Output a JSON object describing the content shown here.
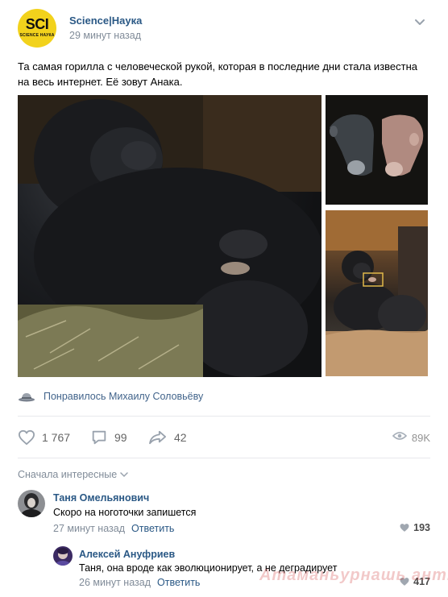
{
  "post": {
    "group_name": "Science|Наука",
    "time": "29 минут назад",
    "avatar_logo": "SCI",
    "avatar_sub": "SCIENCE НАУКА",
    "text": "Та самая горилла с человеческой рукой, которая в последние дни стала известна на весь интернет. Её зовут Анака.",
    "likers_text": "Понравилось Михаилу Соловьёву",
    "likes": "1 767",
    "comments": "99",
    "shares": "42",
    "views": "89K",
    "icons": {
      "menu": "chevron-down-icon",
      "likers": "hat-icon",
      "like": "heart-icon",
      "comment": "comment-icon",
      "share": "share-arrow-icon",
      "views": "eye-icon"
    }
  },
  "comments_section": {
    "sort_label": "Сначала интересные",
    "items": [
      {
        "author": "Таня Омельянович",
        "text": "Скоро на ноготочки запишется",
        "time": "27 минут назад",
        "reply_label": "Ответить",
        "likes": "193"
      },
      {
        "author": "Алексей Ануфриев",
        "text": "Таня, она вроде как эволюционирует, а не деградирует",
        "time": "26 минут назад",
        "reply_label": "Ответить",
        "likes": "417"
      }
    ]
  },
  "watermark": "Атаманьурнашь ант.ЯП",
  "colors": {
    "link": "#2a5885",
    "secondary": "#818c99",
    "divider": "#e7e8ec",
    "avatar_bg": "#f2d21c"
  }
}
